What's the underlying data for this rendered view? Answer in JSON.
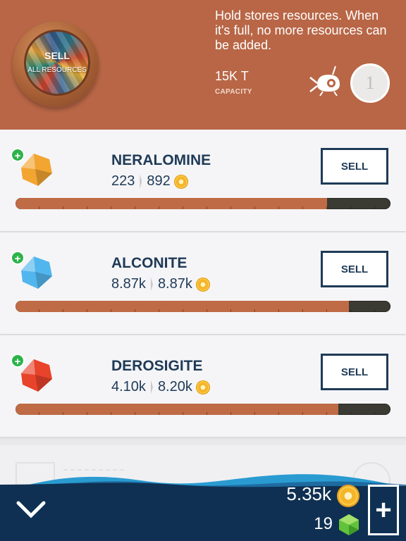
{
  "header": {
    "sell_all_title": "SELL",
    "sell_all_subtitle": "ALL RESOURCES",
    "description": "Hold stores resources. When it's full, no more resources can be added.",
    "capacity_value": "15K T",
    "capacity_label": "CAPACITY",
    "level": "1"
  },
  "resources": [
    {
      "name": "NERALOMINE",
      "amount": "223",
      "value": "892",
      "sell_label": "SELL",
      "fill": 0.83,
      "gem_color": "#f2a531"
    },
    {
      "name": "ALCONITE",
      "amount": "8.87k",
      "value": "8.87k",
      "sell_label": "SELL",
      "fill": 0.89,
      "gem_color": "#52b6ee"
    },
    {
      "name": "DEROSIGITE",
      "amount": "4.10k",
      "value": "8.20k",
      "sell_label": "SELL",
      "fill": 0.86,
      "gem_color": "#e8432b"
    }
  ],
  "currency": {
    "coins": "5.35k",
    "gems": "19"
  },
  "colors": {
    "header_bg": "#b86646",
    "navy": "#1f3a57",
    "bar_fill": "#bf6b45",
    "plus_green": "#2db34a"
  },
  "icons": [
    "porthole-icon",
    "drone-icon",
    "plus-icon",
    "coin-icon",
    "gem-icon",
    "chevron-down-icon"
  ]
}
